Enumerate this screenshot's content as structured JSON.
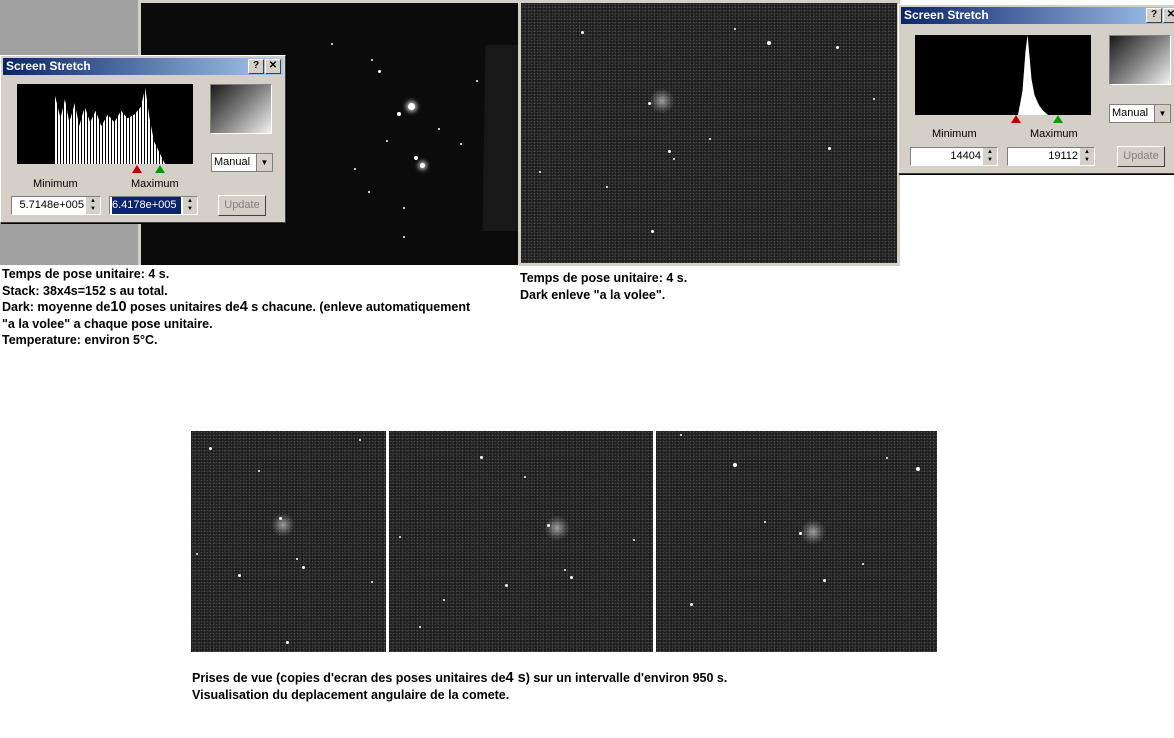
{
  "dialog_left": {
    "title": "Screen Stretch",
    "help_label": "?",
    "close_label": "✕",
    "minimum_label": "Minimum",
    "maximum_label": "Maximum",
    "minimum_value": "5.7148e+005",
    "maximum_value": "6.4178e+005",
    "mode_value": "Manual",
    "update_label": "Update"
  },
  "dialog_right": {
    "title": "Screen Stretch",
    "help_label": "?",
    "close_label": "✕",
    "minimum_label": "Minimum",
    "maximum_label": "Maximum",
    "minimum_value": "14404",
    "maximum_value": "19112",
    "mode_value": "Manual",
    "update_label": "Update"
  },
  "caption_left": {
    "line1": "Temps de pose unitaire: 4 s.",
    "line2": "Stack: 38x4s=152 s au total.",
    "line3_a": "Dark: moyenne de",
    "line3_n1": "10",
    "line3_b": " poses  unitaires de",
    "line3_n2": "4",
    "line3_c": " s chacune. (enleve automatiquement",
    "line4": "\"a la volee\" a chaque pose unitaire.",
    "line5": "Temperature: environ 5°C."
  },
  "caption_right": {
    "line1": "Temps de pose unitaire: 4 s.",
    "line2": "Dark enleve \"a la volee\"."
  },
  "caption_bottom": {
    "line1_a": "Prises de vue (copies d'ecran des poses unitaires de",
    "line1_n": "4 s",
    "line1_b": ") sur un intervalle d'environ 950 s.",
    "line2": "Visualisation du deplacement angulaire de la comete."
  },
  "icons": [
    "help-icon",
    "close-icon",
    "spin-arrows-icon",
    "dropdown-arrow-icon",
    "red-marker-icon",
    "green-marker-icon"
  ],
  "colors": {
    "titlebar_start": "#0a246a",
    "titlebar_end": "#a6caf0",
    "dialog_face": "#d4d0c8"
  }
}
